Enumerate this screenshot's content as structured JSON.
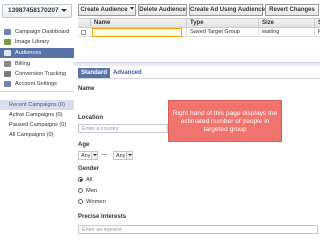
{
  "account": {
    "id": "13987458170207"
  },
  "toolbar": {
    "create_audience": "Create Audience",
    "delete_audience": "Delete Audience",
    "create_ad": "Create Ad Using Audience",
    "revert_changes": "Revert Changes"
  },
  "sidebar": {
    "nav": [
      {
        "label": "Campaign Dashboard",
        "icon": "dashboard-icon",
        "color": "#6d84b4"
      },
      {
        "label": "Image Library",
        "icon": "image-icon",
        "color": "#7a9a4a"
      },
      {
        "label": "Audiences",
        "icon": "audience-icon",
        "color": "#4a6ea9"
      },
      {
        "label": "Billing",
        "icon": "billing-icon",
        "color": "#8a8a8a"
      },
      {
        "label": "Conversion Tracking",
        "icon": "tracking-icon",
        "color": "#7b7b7b"
      },
      {
        "label": "Account Settings",
        "icon": "settings-icon",
        "color": "#6d84b4"
      }
    ],
    "campaigns": [
      {
        "label": "Recent Campaigns (0)"
      },
      {
        "label": "Active Campaigns (0)"
      },
      {
        "label": "Paused Campaigns (0)"
      },
      {
        "label": "All Campaigns (0)"
      }
    ]
  },
  "grid": {
    "headers": {
      "name": "Name",
      "type": "Type",
      "size": "Size",
      "s": "S"
    },
    "rows": [
      {
        "name": "",
        "type": "Saved Target Group",
        "size": "waiting",
        "s": "R"
      }
    ]
  },
  "form": {
    "tabs": {
      "standard": "Standard",
      "advanced": "Advanced"
    },
    "name_label": "Name",
    "location_label": "Location",
    "location_placeholder": "Enter a country",
    "age_label": "Age",
    "age_from": "Any",
    "age_to": "Any",
    "age_sep": "—",
    "gender_label": "Gender",
    "gender_options": [
      "All",
      "Men",
      "Women"
    ],
    "interests_label": "Precise Interests",
    "interests_placeholder": "Enter an interest"
  },
  "callout": {
    "text": "Right hand of this page displays the estimated number of people in targeted group"
  },
  "colors": {
    "accent": "#5973a9",
    "callout": "#f0736e",
    "link": "#3b5998"
  }
}
